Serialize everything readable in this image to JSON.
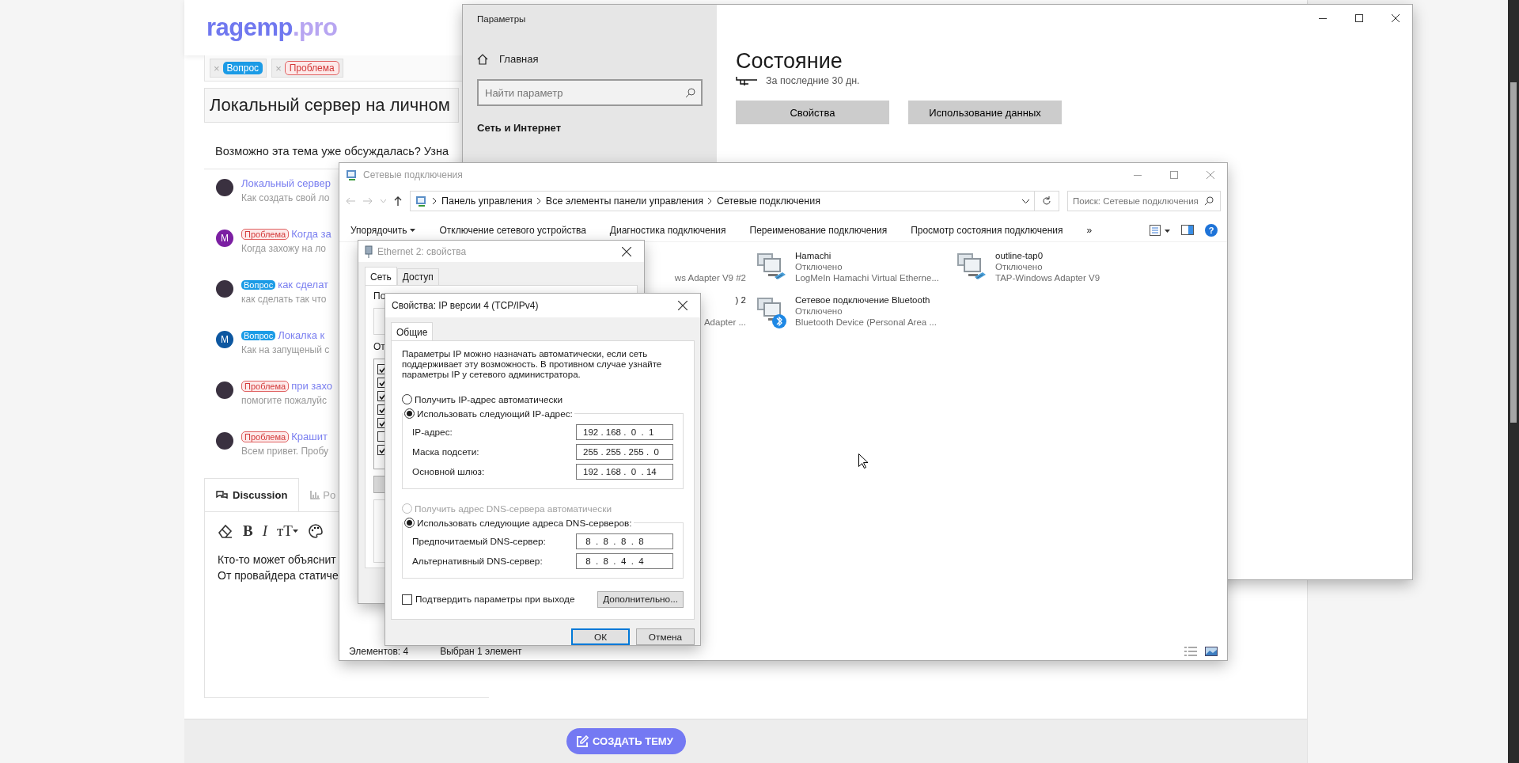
{
  "forum": {
    "logo": {
      "main": "ragemp",
      "suffix": ".pro"
    },
    "prefix_tags": [
      {
        "remove": "×",
        "label": "Вопрос",
        "kind": "question"
      },
      {
        "remove": "×",
        "label": "Проблема",
        "kind": "problem"
      }
    ],
    "title_value": "Локальный сервер на личном",
    "similar_hint": "Возможно эта тема уже обсуждалась? Узна",
    "threads": [
      {
        "avatar": {
          "kind": "photo"
        },
        "title": "Локальный сервер",
        "snippet": "Как создать свой ло"
      },
      {
        "avatar": {
          "kind": "letter",
          "letter": "M",
          "color": "#7b1fa2"
        },
        "tag": {
          "label": "Проблема",
          "kind": "problem"
        },
        "title": "Когда за",
        "snippet": "Когда захожу на ло"
      },
      {
        "avatar": {
          "kind": "photo"
        },
        "tag": {
          "label": "Вопрос",
          "kind": "question"
        },
        "title": "как сделат",
        "snippet": "как сделать так что"
      },
      {
        "avatar": {
          "kind": "letter",
          "letter": "M",
          "color": "#0d57a0"
        },
        "tag": {
          "label": "Вопрос",
          "kind": "question"
        },
        "title": "Локалка к",
        "snippet": "Как на запущеный с"
      },
      {
        "avatar": {
          "kind": "photo"
        },
        "tag": {
          "label": "Проблема",
          "kind": "problem"
        },
        "title": "при захо",
        "snippet": "помогите пожалуйс"
      },
      {
        "avatar": {
          "kind": "photo"
        },
        "tag": {
          "label": "Проблема",
          "kind": "problem"
        },
        "title": "Крашит",
        "snippet": "Всем привет. Пробу"
      }
    ],
    "tabs": [
      {
        "label": "Discussion",
        "selected": true
      },
      {
        "label": "Po",
        "selected": false
      }
    ],
    "editor_tools": [
      {
        "kind": "eraser"
      },
      {
        "kind": "bold",
        "glyph": "B"
      },
      {
        "kind": "italic",
        "glyph": "I"
      },
      {
        "kind": "size",
        "glyph": "тT"
      },
      {
        "kind": "palette"
      }
    ],
    "editor_lines": [
      "Кто-то может объяснит",
      "От провайдера статиче"
    ],
    "create_button": "СОЗДАТЬ ТЕМУ"
  },
  "settings_window": {
    "title": "Параметры",
    "home": "Главная",
    "search_placeholder": "Найти параметр",
    "section": "Сеть и Интернет",
    "heading": "Состояние",
    "period": "За последние 30 дн.",
    "buttons": [
      "Свойства",
      "Использование данных"
    ]
  },
  "network_window": {
    "title": "Сетевые подключения",
    "breadcrumbs": [
      "Панель управления",
      "Все элементы панели управления",
      "Сетевые подключения"
    ],
    "search_placeholder": "Поиск: Сетевые подключения",
    "toolbar": [
      {
        "label": "Упорядочить",
        "dropdown": true
      },
      {
        "label": "Отключение сетевого устройства",
        "dropdown": false
      },
      {
        "label": "Диагностика подключения",
        "dropdown": false
      },
      {
        "label": "Переименование подключения",
        "dropdown": false
      },
      {
        "label": "Просмотр состояния подключения",
        "dropdown": false
      }
    ],
    "more": "»",
    "help": "?",
    "connections": [
      {
        "kind": "partial",
        "device": "ws Adapter V9 #2"
      },
      {
        "kind": "partial",
        "name": ") 2",
        "device": "Adapter ..."
      },
      {
        "kind": "network",
        "name": "Hamachi",
        "status": "Отключено",
        "device": "LogMeIn Hamachi Virtual Etherne..."
      },
      {
        "kind": "bluetooth",
        "name": "Сетевое подключение Bluetooth",
        "status": "Отключено",
        "device": "Bluetooth Device (Personal Area ..."
      },
      {
        "kind": "network",
        "name": "outline-tap0",
        "status": "Отключено",
        "device": "TAP-Windows Adapter V9"
      }
    ],
    "status": [
      "Элементов: 4",
      "Выбран 1 элемент"
    ]
  },
  "ethernet_window": {
    "title": "Ethernet 2: свойства",
    "tabs": [
      {
        "label": "Сеть",
        "selected": true
      },
      {
        "label": "Доступ",
        "selected": false
      }
    ],
    "labels": [
      "По",
      "От"
    ],
    "components": [
      {
        "checked": true
      },
      {
        "checked": true
      },
      {
        "checked": true
      },
      {
        "checked": true
      },
      {
        "checked": true
      },
      {
        "checked": false
      },
      {
        "checked": true
      }
    ]
  },
  "ipv4_dialog": {
    "title": "Свойства: IP версии 4 (TCP/IPv4)",
    "tabs": [
      {
        "label": "Общие",
        "selected": true
      }
    ],
    "description": "Параметры IP можно назначать автоматически, если сеть поддерживает эту возможность. В противном случае узнайте параметры IP у сетевого администратора.",
    "ip_mode": [
      {
        "label": "Получить IP-адрес автоматически",
        "selected": false,
        "disabled": false
      },
      {
        "label": "Использовать следующий IP-адрес:",
        "selected": true,
        "disabled": false
      }
    ],
    "ip_fields": [
      {
        "label": "IP-адрес:",
        "value": "192 . 168 .  0  .  1"
      },
      {
        "label": "Маска подсети:",
        "value": "255 . 255 . 255 .  0"
      },
      {
        "label": "Основной шлюз:",
        "value": "192 . 168 .  0  . 14"
      }
    ],
    "dns_mode": [
      {
        "label": "Получить адрес DNS-сервера автоматически",
        "selected": false,
        "disabled": true
      },
      {
        "label": "Использовать следующие адреса DNS-серверов:",
        "selected": true,
        "disabled": false
      }
    ],
    "dns_fields": [
      {
        "label": "Предпочитаемый DNS-сервер:",
        "value": " 8  .  8  .  8  .  8"
      },
      {
        "label": "Альтернативный DNS-сервер:",
        "value": " 8  .  8  .  4  .  4"
      }
    ],
    "validate": {
      "label": "Подтвердить параметры при выходе",
      "checked": false
    },
    "advanced_button": "Дополнительно...",
    "ok_button": "ОК",
    "cancel_button": "Отмена"
  }
}
